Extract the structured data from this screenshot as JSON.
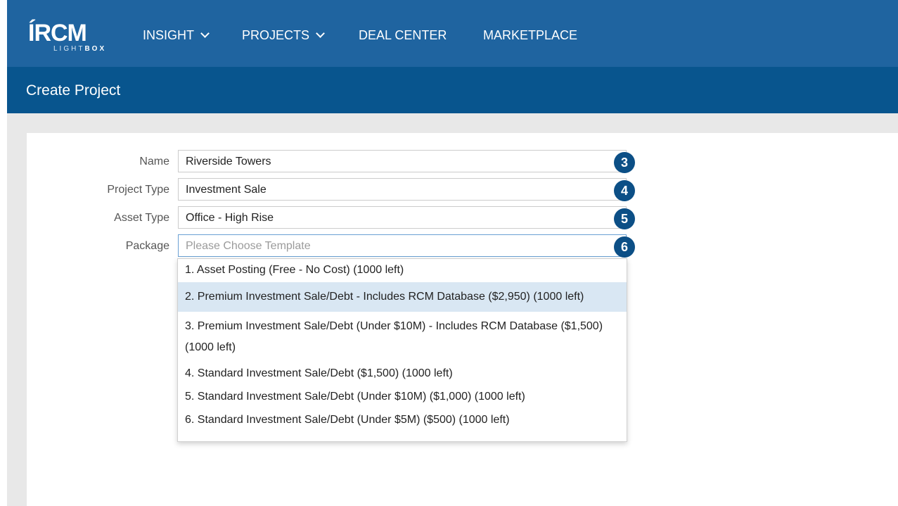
{
  "nav": {
    "logo_mark": "ÍRCM",
    "logo_sub_light": "LIGHT",
    "logo_sub_bold": "BOX",
    "items": [
      {
        "label": "INSIGHT",
        "has_dropdown": true
      },
      {
        "label": "PROJECTS",
        "has_dropdown": true
      },
      {
        "label": "DEAL CENTER",
        "has_dropdown": false
      },
      {
        "label": "MARKETPLACE",
        "has_dropdown": false
      }
    ]
  },
  "page": {
    "title": "Create Project"
  },
  "form": {
    "fields": [
      {
        "label": "Name",
        "value": "Riverside Towers",
        "badge": "3"
      },
      {
        "label": "Project Type",
        "value": "Investment Sale",
        "badge": "4"
      },
      {
        "label": "Asset Type",
        "value": "Office - High Rise",
        "badge": "5"
      },
      {
        "label": "Package",
        "value": "",
        "placeholder": "Please Choose Template",
        "badge": "6"
      }
    ]
  },
  "package_options": [
    "1. Asset Posting (Free - No Cost) (1000 left)",
    "2. Premium Investment Sale/Debt - Includes RCM Database ($2,950) (1000 left)",
    "3. Premium Investment Sale/Debt (Under $10M) - Includes RCM Database ($1,500) (1000 left)",
    "4. Standard Investment Sale/Debt ($1,500) (1000 left)",
    "5. Standard Investment Sale/Debt (Under $10M) ($1,000) (1000 left)",
    "6. Standard Investment Sale/Debt (Under $5M) ($500) (1000 left)"
  ],
  "highlighted_option_index": 1,
  "colors": {
    "nav_bg": "#1f64a0",
    "subheader_bg": "#08558e",
    "badge_bg": "#0c4f86",
    "highlight_bg": "#d9e7f3"
  }
}
